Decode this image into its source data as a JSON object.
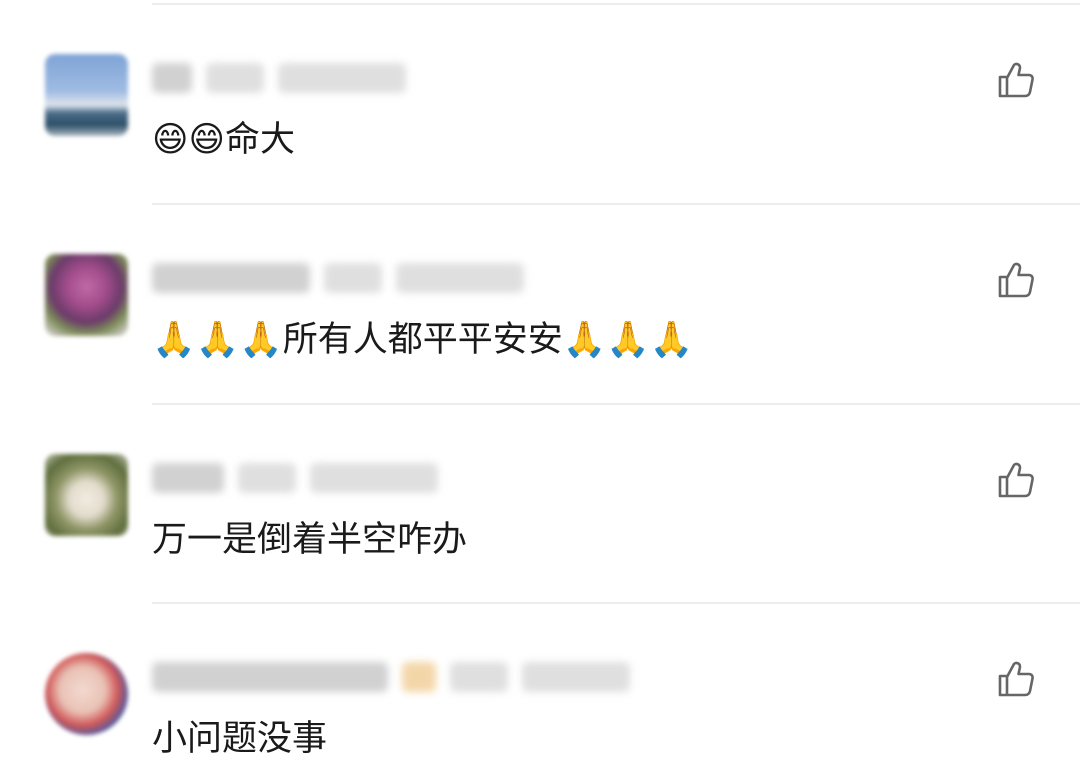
{
  "comments": [
    {
      "author": "",
      "source": "",
      "time": "",
      "text": "😄😄命大",
      "avatar": "landscape-photo"
    },
    {
      "author": "",
      "source": "",
      "time": "",
      "text": "🙏🙏🙏所有人都平平安安🙏🙏🙏",
      "avatar": "flower-photo"
    },
    {
      "author": "",
      "source": "",
      "time": "",
      "text": "万一是倒着半空咋办",
      "avatar": "dog-photo"
    },
    {
      "author": "",
      "source": "",
      "time": "",
      "text": "小问题没事",
      "avatar": "person-photo"
    }
  ],
  "icons": {
    "like": "thumbs-up-icon"
  },
  "colors": {
    "text": "#1a1a1a",
    "divider": "#ececec",
    "icon": "#666666"
  }
}
